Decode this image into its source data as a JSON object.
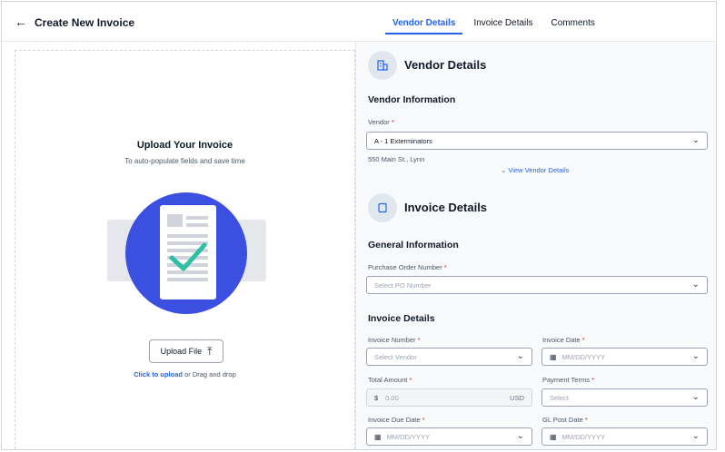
{
  "header": {
    "back_icon": "arrow-left-icon",
    "title": "Create New Invoice",
    "tabs": [
      {
        "label": "Vendor Details",
        "active": true
      },
      {
        "label": "Invoice Details",
        "active": false
      },
      {
        "label": "Comments",
        "active": false
      }
    ]
  },
  "upload": {
    "title": "Upload Your Invoice",
    "subtitle": "To auto-populate fields and save time",
    "button_label": "Upload File",
    "button_icon": "upload-icon",
    "hint_link": "Click to upload",
    "hint_rest": " or Drag and drop"
  },
  "vendor_section": {
    "icon": "building-icon",
    "title": "Vendor Details",
    "subtitle": "Vendor Information",
    "vendor_label": "Vendor",
    "vendor_value": "A - 1 Exterminators",
    "address": "550 Main St., Lynn",
    "view_link": "View Vendor Details"
  },
  "invoice_section": {
    "icon": "document-icon",
    "title": "Invoice Details",
    "general_title": "General Information",
    "po_label": "Purchase Order Number",
    "po_placeholder": "Select PO Number",
    "details_title": "Invoice Details",
    "invoice_number_label": "Invoice Number",
    "invoice_number_placeholder": "Select Vendor",
    "invoice_date_label": "Invoice Date",
    "invoice_date_placeholder": "MM/DD/YYYY",
    "total_amount_label": "Total Amount",
    "total_amount_prefix": "$",
    "total_amount_placeholder": "0.00",
    "total_amount_currency": "USD",
    "payment_terms_label": "Payment Terms",
    "payment_terms_placeholder": "Select",
    "due_date_label": "Invoice Due Date",
    "due_date_placeholder": "MM/DD/YYYY",
    "gl_date_label": "GL Post Date",
    "gl_date_placeholder": "MM/DD/YYYY"
  },
  "required_mark": "*",
  "colors": {
    "accent": "#2563eb",
    "illustration_circle": "#3b4fe0",
    "check": "#2ebfa5"
  }
}
